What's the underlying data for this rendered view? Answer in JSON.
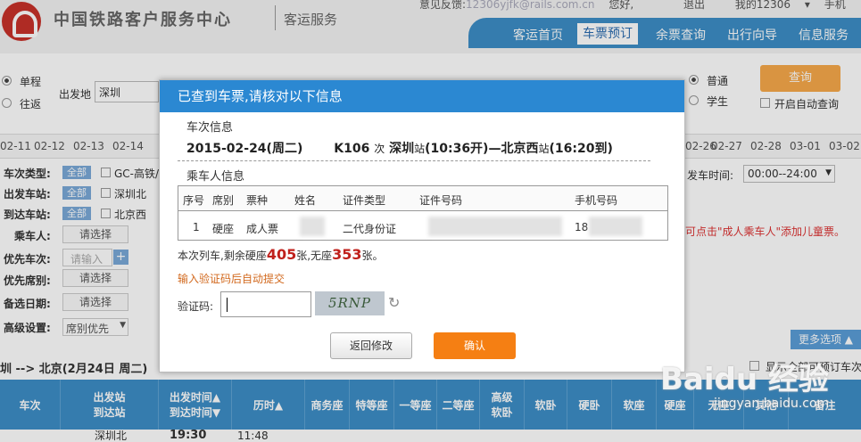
{
  "header": {
    "title": "中国铁路客户服务中心",
    "subtitle": "客运服务",
    "feedback_label": "意见反馈:",
    "feedback_mail": "12306yjfk@rails.com.cn",
    "greeting": "您好,",
    "logout": "退出",
    "my12306": "我的12306",
    "mobile": "手机"
  },
  "nav": {
    "items": [
      "客运首页",
      "车票预订",
      "余票查询",
      "出行向导",
      "信息服务"
    ],
    "active": "车票预订"
  },
  "query": {
    "trip_single": "单程",
    "trip_round": "往返",
    "from_label": "出发地",
    "from_value": "深圳",
    "type_normal": "普通",
    "type_student": "学生",
    "auto_query": "开启自动查询",
    "query_button": "查询"
  },
  "dates": [
    "02-11",
    "02-12",
    "02-13",
    "02-14",
    "02-26",
    "02-27",
    "02-28",
    "03-01",
    "03-02"
  ],
  "filters": {
    "train_type": "车次类型:",
    "depart_station": "出发车站:",
    "arrive_station": "到达车站:",
    "passenger": "乘车人:",
    "priority_train": "优先车次:",
    "priority_seat": "优先席别:",
    "backup_date": "备选日期:",
    "advanced": "高级设置:",
    "all": "全部",
    "gc": "GC-高铁/",
    "shenzhenbei": "深圳北",
    "beijingxi": "北京西",
    "choose": "请选择",
    "input_placeholder": "请输入",
    "seat_priority": "席别优先",
    "depart_time_label": "发车时间:",
    "depart_time_value": "00:00--24:00",
    "child_hint": "可点击\"成人乘车人\"添加儿童票。",
    "more": "更多选项",
    "show_all": "显示全部可预订车次"
  },
  "result": {
    "route_line": "圳 --> 北京(2月24日 周二)",
    "headers": [
      "车次",
      "出发站\n到达站",
      "出发时间▲\n到达时间▼",
      "历时▲",
      "商务座",
      "特等座",
      "一等座",
      "二等座",
      "高级\n软卧",
      "软卧",
      "硬卧",
      "软座",
      "硬座",
      "无座",
      "其他",
      "备注"
    ],
    "row_station": "深圳北",
    "row_time": "19:30",
    "row_duration": "11:48"
  },
  "dialog": {
    "title": "已查到车票,请核对以下信息",
    "train_info_label": "车次信息",
    "date": "2015-02-24(周二)",
    "train_no": "K106",
    "ci": "次",
    "from": "深圳",
    "zhan": "站",
    "depart": "(10:36开)",
    "dash": "—",
    "to": "北京西",
    "arrive": "(16:20到)",
    "passenger_label": "乘车人信息",
    "table_headers": [
      "序号",
      "席别",
      "票种",
      "姓名",
      "证件类型",
      "证件号码",
      "手机号码"
    ],
    "rows": [
      {
        "no": "1",
        "seat": "硬座",
        "ticket": "成人票",
        "id_type": "二代身份证",
        "phone_prefix": "18"
      }
    ],
    "remain_prefix": "本次列车,剩余硬座",
    "remain_hard": "405",
    "remain_mid": "张,无座",
    "remain_none": "353",
    "remain_suffix": "张。",
    "auto_submit": "输入验证码后自动提交",
    "captcha_label": "验证码:",
    "captcha_text": "5RNP",
    "back_button": "返回修改",
    "confirm_button": "确认"
  },
  "watermark": {
    "brand": "Baidu 经验",
    "url": "jingyan.baidu.com"
  }
}
